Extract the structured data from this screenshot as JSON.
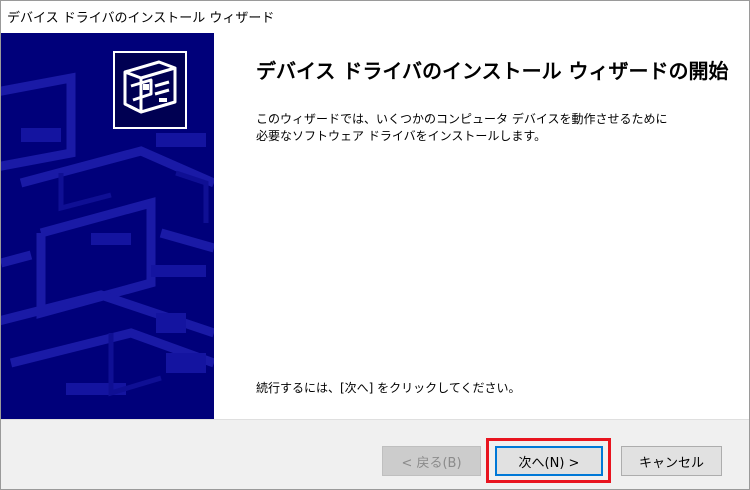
{
  "window": {
    "title": "デバイス ドライバのインストール ウィザード"
  },
  "content": {
    "heading": "デバイス ドライバのインストール ウィザードの開始",
    "intro_line1": "このウィザードでは、いくつかのコンピュータ デバイスを動作させるために",
    "intro_line2": "必要なソフトウェア ドライバをインストールします。",
    "continue_text": "続行するには、[次へ] をクリックしてください。"
  },
  "buttons": {
    "back": {
      "label": "< 戻る(B)",
      "enabled": false
    },
    "next": {
      "label": "次へ(N) >",
      "enabled": true,
      "focused": true
    },
    "cancel": {
      "label": "キャンセル",
      "enabled": true
    }
  },
  "colors": {
    "panel_blue": "#00007a",
    "accent_focus": "#0078d7",
    "highlight_red": "#e8141f",
    "button_bar": "#f0f0f0"
  },
  "icons": {
    "wizard_logo": "hardware-device-icon"
  }
}
